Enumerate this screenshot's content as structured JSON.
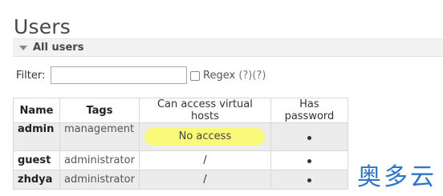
{
  "page": {
    "title": "Users"
  },
  "section": {
    "title": "All users"
  },
  "filter": {
    "label": "Filter:",
    "value": "",
    "regex_label": "Regex",
    "regex_help": "(?)(?)",
    "regex_checked": false
  },
  "table": {
    "headers": [
      "Name",
      "Tags",
      "Can access virtual hosts",
      "Has password"
    ],
    "rows": [
      {
        "name": "admin",
        "tags": "management",
        "vhosts": "No access",
        "has_password": true
      },
      {
        "name": "guest",
        "tags": "administrator",
        "vhosts": "/",
        "has_password": true
      },
      {
        "name": "zhdya",
        "tags": "administrator",
        "vhosts": "/",
        "has_password": true
      }
    ]
  },
  "watermark": {
    "text": "奥多云"
  }
}
